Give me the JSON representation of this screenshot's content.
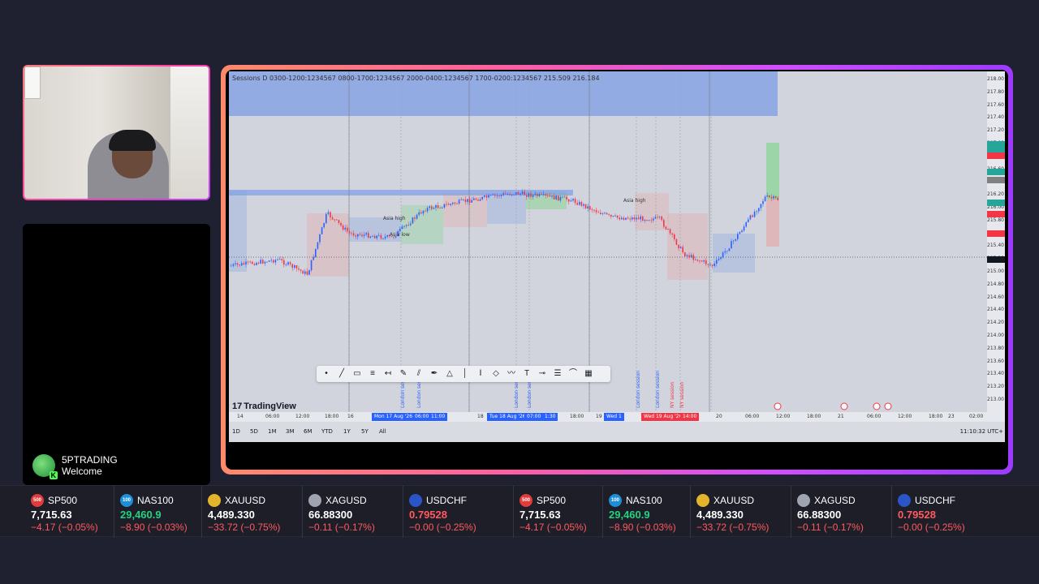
{
  "chat": {
    "user": "5PTRADING",
    "message": "Welcome"
  },
  "chart": {
    "legend": "Sessions D 0300-1200:1234567 0800-1700:1234567 2000-0400:1234567 1700-0200:1234567 215.509 216.184",
    "logo": "TradingView",
    "price_ticks": [
      "218.00",
      "217.80",
      "217.60",
      "217.40",
      "217.20",
      "217.00",
      "216.80",
      "216.60",
      "216.40",
      "216.20",
      "216.00",
      "215.80",
      "215.60",
      "215.40",
      "215.20",
      "215.00",
      "214.80",
      "214.60",
      "214.40",
      "214.20",
      "214.00",
      "213.80",
      "213.60",
      "213.40",
      "213.20",
      "213.00"
    ],
    "time_ticks": [
      "14",
      "06:00",
      "12:00",
      "18:00",
      "16",
      "18:00",
      "18",
      "18:00",
      "19",
      "20",
      "06:00",
      "12:00",
      "18:00",
      "21",
      "06:00",
      "12:00",
      "18:00",
      "23",
      "02:00"
    ],
    "time_highlights": [
      "Mon 17 Aug '26",
      "06:00",
      "11:00",
      "Tue 18 Aug '26",
      "07:00",
      "1:30",
      "Wed 1",
      "Wed 19 Aug '26",
      "14:00"
    ],
    "annotations": [
      "Asia high",
      "Asia high",
      "Asia low",
      "London session",
      "London session",
      "London session",
      "London session",
      "London session",
      "London session",
      "NY session",
      "NY session"
    ],
    "range_buttons": [
      "1D",
      "5D",
      "1M",
      "3M",
      "6M",
      "YTD",
      "1Y",
      "5Y",
      "All"
    ],
    "clock": "11:10:32 UTC+",
    "colors": {
      "up": "#2962ff",
      "down": "#f23645",
      "session_blue": "#7d9ee6",
      "session_green": "#8fd49a",
      "session_red": "#e6a3a3"
    }
  },
  "toolbar": {
    "tools": [
      "dot-icon",
      "line-icon",
      "rect-icon",
      "fib-icon",
      "ray-icon",
      "brush-icon",
      "channel-icon",
      "pen-icon",
      "measure-icon",
      "vline-icon",
      "text-range-icon",
      "ellipse-icon",
      "path-icon",
      "text-icon",
      "hline-icon",
      "lines-icon",
      "curve-icon",
      "table-icon"
    ]
  },
  "ticker": [
    {
      "badge": "500",
      "color": "#e23b3b",
      "symbol": "SP500",
      "price": "7,715.63",
      "change": "−4.17 (−0.05%)",
      "price_color": "#ffffff"
    },
    {
      "badge": "100",
      "color": "#1e8fd6",
      "symbol": "NAS100",
      "price": "29,460.9",
      "change": "−8.90 (−0.03%)",
      "price_color": "#26d17f"
    },
    {
      "badge": "",
      "color": "#e4b52a",
      "symbol": "XAUUSD",
      "price": "4,489.330",
      "change": "−33.72 (−0.75%)",
      "price_color": "#ffffff"
    },
    {
      "badge": "",
      "color": "#a0a4b0",
      "symbol": "XAGUSD",
      "price": "66.88300",
      "change": "−0.11 (−0.17%)",
      "price_color": "#ffffff"
    },
    {
      "badge": "",
      "color": "#2a55c8",
      "symbol": "USDCHF",
      "price": "0.79528",
      "change": "−0.00 (−0.25%)",
      "price_color": "#ff5a5f"
    },
    {
      "badge": "500",
      "color": "#e23b3b",
      "symbol": "SP500",
      "price": "7,715.63",
      "change": "−4.17 (−0.05%)",
      "price_color": "#ffffff"
    },
    {
      "badge": "100",
      "color": "#1e8fd6",
      "symbol": "NAS100",
      "price": "29,460.9",
      "change": "−8.90 (−0.03%)",
      "price_color": "#26d17f"
    },
    {
      "badge": "",
      "color": "#e4b52a",
      "symbol": "XAUUSD",
      "price": "4,489.330",
      "change": "−33.72 (−0.75%)",
      "price_color": "#ffffff"
    },
    {
      "badge": "",
      "color": "#a0a4b0",
      "symbol": "XAGUSD",
      "price": "66.88300",
      "change": "−0.11 (−0.17%)",
      "price_color": "#ffffff"
    },
    {
      "badge": "",
      "color": "#2a55c8",
      "symbol": "USDCHF",
      "price": "0.79528",
      "change": "−0.00 (−0.25%)",
      "price_color": "#ff5a5f"
    }
  ]
}
